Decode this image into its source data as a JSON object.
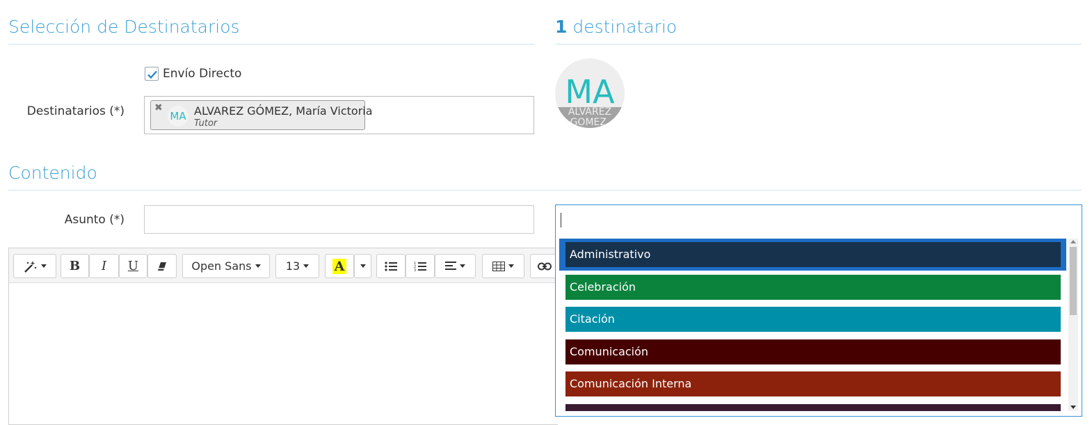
{
  "recipients_section": {
    "title": "Selección de Destinatarios",
    "direct_send_label": "Envío Directo",
    "direct_send_checked": true,
    "recipients_label": "Destinatarios (*)",
    "chip": {
      "remove_glyph": "✖",
      "initials": "MA",
      "name": "ALVAREZ GÓMEZ, María Victoria",
      "role": "Tutor"
    }
  },
  "summary": {
    "count": "1",
    "count_label": "destinatario",
    "avatar_initials": "MA",
    "avatar_caption": "ALVAREZ GOMEZ, María"
  },
  "content_section": {
    "title": "Contenido",
    "subject_label": "Asunto (*)",
    "subject_value": ""
  },
  "toolbar": {
    "magic_icon": "magic-wand-icon",
    "bold": "B",
    "italic": "I",
    "underline": "U",
    "font_name": "Open Sans",
    "font_size": "13",
    "highlight_letter": "A",
    "highlight_color": "#ffff00"
  },
  "tag_dropdown": {
    "search_value": "",
    "items": [
      {
        "label": "Administrativo",
        "color": "#17324d"
      },
      {
        "label": "Celebración",
        "color": "#0b833d"
      },
      {
        "label": "Citación",
        "color": "#008fa8"
      },
      {
        "label": "Comunicación",
        "color": "#470000"
      },
      {
        "label": "Comunicación Interna",
        "color": "#8d220c"
      },
      {
        "label": "",
        "color": "#3a1b30"
      }
    ],
    "highlight_color": "#1e6ec6"
  },
  "colors": {
    "title_blue": "#3a9fd6",
    "avatar_teal": "#26bcbe"
  }
}
